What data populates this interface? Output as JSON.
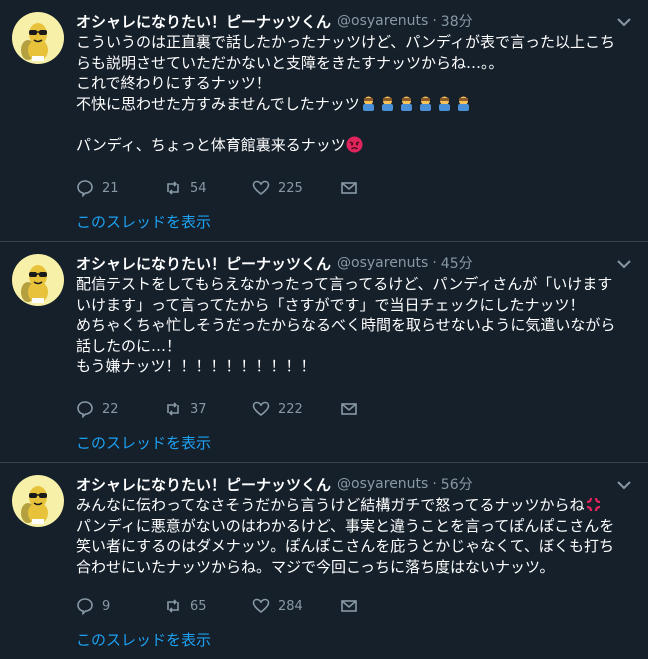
{
  "tweets": [
    {
      "name": "オシャレになりたい！ピーナッツくん",
      "handle": "@osyarenuts",
      "dot": "·",
      "time": "38分",
      "lines": [
        "こういうのは正直裏で話したかったナッツけど、パンディが表で言った以上こち",
        "らも説明させていただかないと支障をきたすナッツからね…。。",
        "これで終わりにするナッツ！",
        "不快に思わせた方すみませんでしたナッツ",
        "",
        "パンディ、ちょっと体育館裏来るナッツ"
      ],
      "emoji": {
        "bow_count": 6,
        "angry": "angry-face"
      },
      "reply_count": "21",
      "retweet_count": "54",
      "like_count": "225",
      "thread_link": "このスレッドを表示"
    },
    {
      "name": "オシャレになりたい！ピーナッツくん",
      "handle": "@osyarenuts",
      "dot": "·",
      "time": "45分",
      "lines": [
        "配信テストをしてもらえなかったって言ってるけど、パンディさんが「いけます",
        "いけます」って言ってたから「さすがです」で当日チェックにしたナッツ！",
        "めちゃくちゃ忙しそうだったからなるべく時間を取らせないように気遣いながら",
        "話したのに…！",
        "もう嫌ナッツ！！！！！！！！！！"
      ],
      "reply_count": "22",
      "retweet_count": "37",
      "like_count": "222",
      "thread_link": "このスレッドを表示"
    },
    {
      "name": "オシャレになりたい！ピーナッツくん",
      "handle": "@osyarenuts",
      "dot": "·",
      "time": "56分",
      "lines": [
        "みんなに伝わってなさそうだから言うけど結構ガチで怒ってるナッツからね",
        "パンディに悪意がないのはわかるけど、事実と違うことを言ってぽんぽこさんを",
        "笑い者にするのはダメナッツ。ぽんぽこさんを庇うとかじゃなくて、ぼくも打ち",
        "合わせにいたナッツからね。マジで今回こっちに落ち度はないナッツ。"
      ],
      "emoji": {
        "anger": "anger-symbol"
      },
      "reply_count": "9",
      "retweet_count": "65",
      "like_count": "284",
      "thread_link": "このスレッドを表示"
    }
  ],
  "colors": {
    "background": "#15202b",
    "divider": "#38444d",
    "secondary_text": "#8899a6",
    "link": "#1da1f2",
    "anger": "#e0245e"
  }
}
